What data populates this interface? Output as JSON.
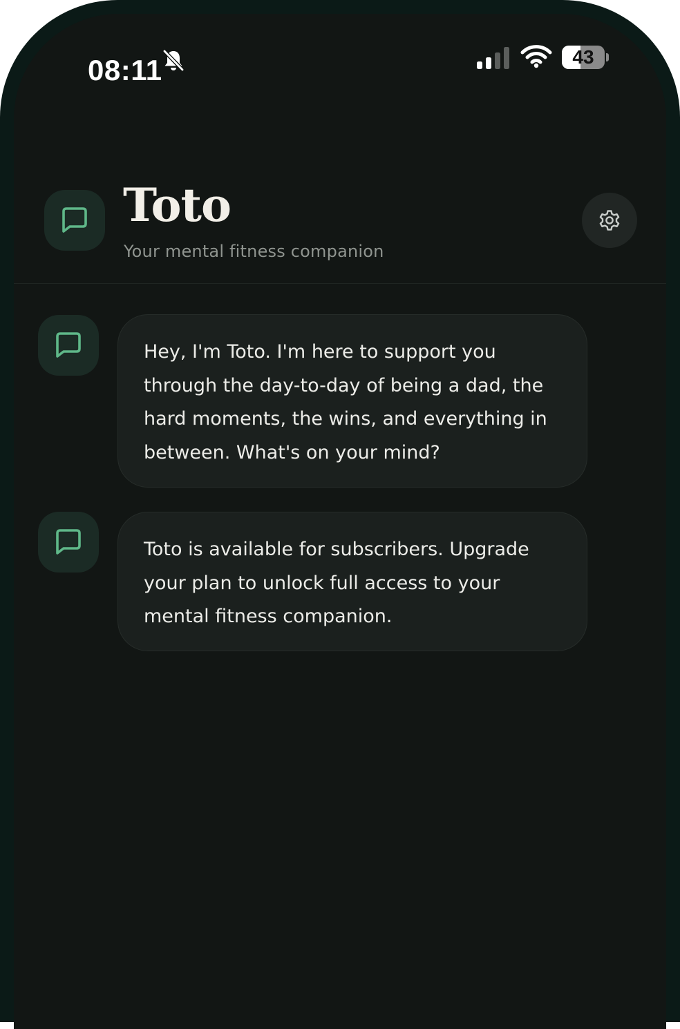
{
  "status_bar": {
    "time": "08:11",
    "battery_percent": "43",
    "battery_level": 0.43,
    "icons": [
      "bell-slash-icon",
      "cellular-signal-icon",
      "wifi-icon",
      "battery-icon"
    ]
  },
  "header": {
    "title": "Toto",
    "subtitle": "Your mental fitness companion",
    "icon": "chat-bubble-icon",
    "settings_icon": "gear-icon"
  },
  "messages": [
    {
      "sender_icon": "chat-bubble-icon",
      "text": "Hey, I'm Toto. I'm here to support you through the day-to-day of being a dad, the hard moments, the wins, and everything in between. What's on your mind?"
    },
    {
      "sender_icon": "chat-bubble-icon",
      "text": "Toto is available for subscribers. Upgrade your plan to unlock full access to your mental fitness companion."
    }
  ],
  "colors": {
    "background": "#121614",
    "accent": "#5fb889",
    "bubble": "#1b201e",
    "bezel": "#0b1a17"
  }
}
